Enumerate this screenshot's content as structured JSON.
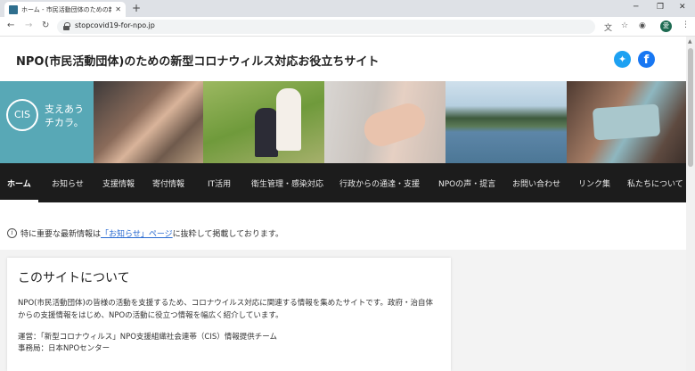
{
  "browser": {
    "tab_title": "ホーム - 市民活動団体のための新型",
    "new_tab": "+",
    "url": "stopcovid19-for-npo.jp",
    "profile_initial": "愛"
  },
  "header": {
    "site_title": "NPO(市民活動団体)のための新型コロナウィルス対応お役立ちサイト"
  },
  "banner": {
    "logo_text": "CIS",
    "tagline_line1": "支えあう",
    "tagline_line2": "チカラ。"
  },
  "nav": {
    "items": [
      {
        "label": "ホーム"
      },
      {
        "label": "お知らせ"
      },
      {
        "label": "支援情報"
      },
      {
        "label": "寄付情報"
      },
      {
        "label": "IT活用"
      },
      {
        "label": "衛生管理・感染対応"
      },
      {
        "label": "行政からの通達・支援"
      },
      {
        "label": "NPOの声・提言"
      },
      {
        "label": "お問い合わせ"
      },
      {
        "label": "リンク集"
      },
      {
        "label": "私たちについて"
      }
    ]
  },
  "notice": {
    "prefix": "特に重要な最新情報は",
    "link": "「お知らせ」ページ",
    "suffix": "に抜粋して掲載しております。"
  },
  "about": {
    "title": "このサイトについて",
    "body": "NPO(市民活動団体)の皆様の活動を支援するため、コロナウイルス対応に関連する情報を集めたサイトです。政府・治自体からの支援情報をはじめ、NPOの活動に役立つ情報を幅広く紹介しています。",
    "operator": "運営：「新型コロナウィルス」NPO支援組織社会連帯（CIS）情報提供チーム",
    "office": "事務局：日本NPOセンター"
  },
  "colors": {
    "banner_teal": "#58a8b6",
    "navbar_bg": "#1c1c1c",
    "twitter_blue": "#1da1f2",
    "facebook_blue": "#1877f2",
    "link_blue": "#2a6bd1"
  }
}
